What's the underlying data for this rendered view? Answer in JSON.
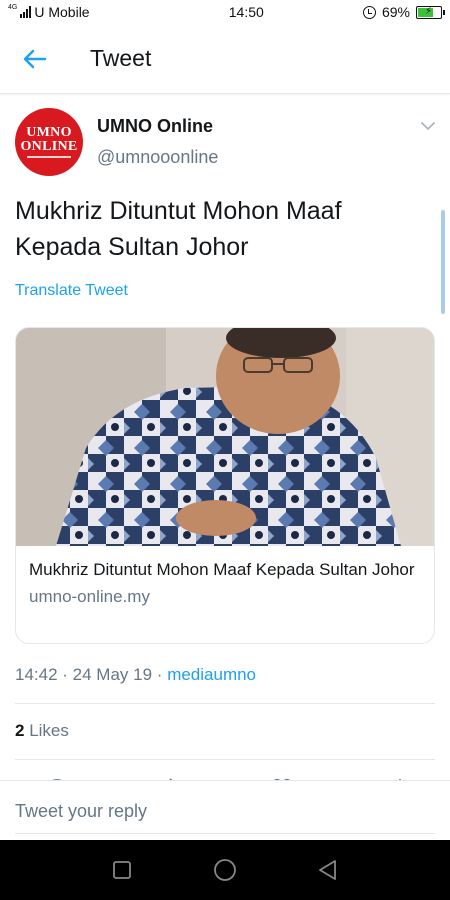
{
  "status_bar": {
    "network_type": "4G",
    "carrier": "U Mobile",
    "time": "14:50",
    "battery": "69%",
    "battery_level": 0.69
  },
  "header": {
    "title": "Tweet"
  },
  "tweet": {
    "author_name": "UMNO Online",
    "author_handle": "@umnooonline",
    "avatar_text_1": "UMNO",
    "avatar_text_2": "ONLINE",
    "text": "Mukhriz Dituntut Mohon Maaf Kepada Sultan Johor",
    "translate_label": "Translate Tweet",
    "card": {
      "title": "Mukhriz Dituntut Mohon Maaf Kepada Sultan Johor",
      "domain": "umno-online.my"
    },
    "time": "14:42",
    "date": "24 May 19",
    "source": "mediaumno",
    "likes_count": "2",
    "likes_label": "Likes"
  },
  "reply": {
    "placeholder": "Tweet your reply"
  },
  "colors": {
    "accent": "#1da1f2",
    "secondary_text": "#657786",
    "avatar_red": "#d81920"
  }
}
